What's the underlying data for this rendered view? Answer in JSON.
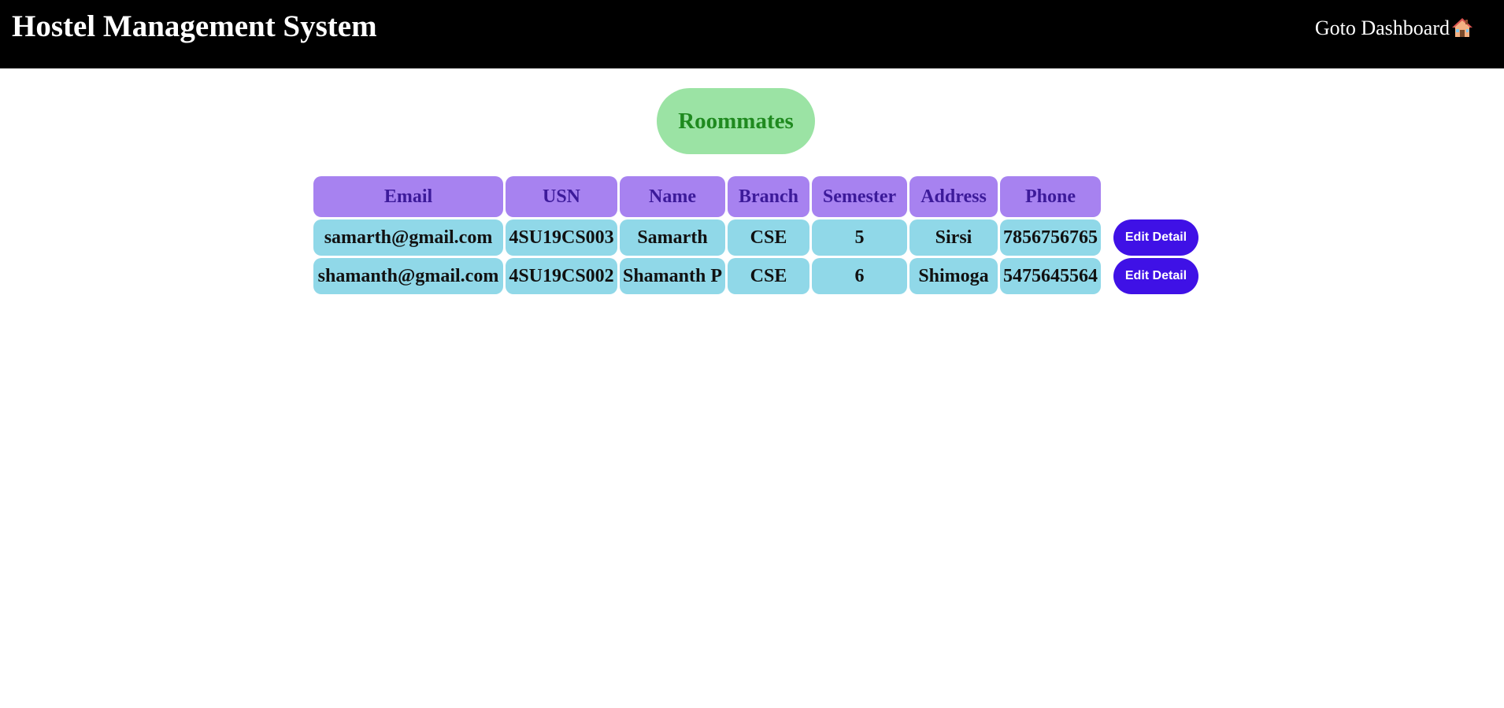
{
  "header": {
    "title": "Hostel Management System",
    "dashboard_link": "Goto Dashboard"
  },
  "icons": {
    "dashboard": "house-icon"
  },
  "section_title": "Roommates",
  "table": {
    "columns": [
      "Email",
      "USN",
      "Name",
      "Branch",
      "Semester",
      "Address",
      "Phone"
    ],
    "rows": [
      {
        "email": "samarth@gmail.com",
        "usn": "4SU19CS003",
        "name": "Samarth",
        "branch": "CSE",
        "semester": "5",
        "address": "Sirsi",
        "phone": "7856756765",
        "action": "Edit Detail"
      },
      {
        "email": "shamanth@gmail.com",
        "usn": "4SU19CS002",
        "name": "Shamanth P",
        "branch": "CSE",
        "semester": "6",
        "address": "Shimoga",
        "phone": "5475645564",
        "action": "Edit Detail"
      }
    ]
  },
  "colors": {
    "topbar": "#000000",
    "heading_bg": "#9be3a4",
    "heading_text": "#1f8a1f",
    "table_header_bg": "#a782f0",
    "table_header_text": "#3c1a9a",
    "table_cell_bg": "#90d8e8",
    "button_bg": "#3f11e6"
  }
}
